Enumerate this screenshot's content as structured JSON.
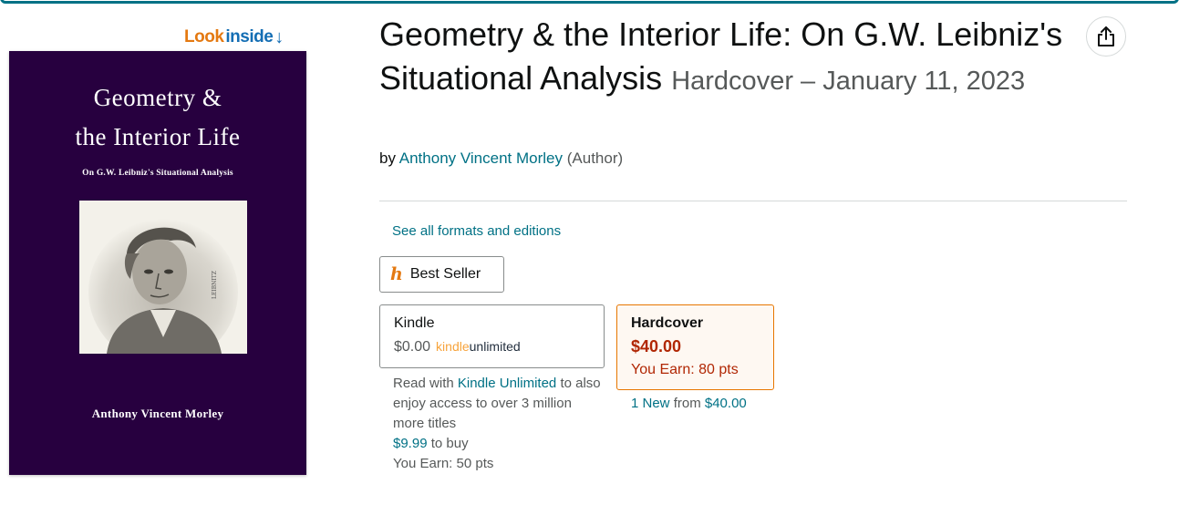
{
  "look_inside": {
    "word1": "Look",
    "word2": "inside",
    "arrow": "↓"
  },
  "cover": {
    "title_line1": "Geometry &",
    "title_line2": "the Interior Life",
    "subtitle": "On G.W. Leibniz's Situational Analysis",
    "author": "Anthony Vincent Morley",
    "portrait_caption": "LEIBNITZ"
  },
  "product": {
    "title": "Geometry & the Interior Life: On G.W. Leibniz's Situational Analysis",
    "format_date": "Hardcover – January 11, 2023",
    "by": "by",
    "author": "Anthony Vincent Morley",
    "role": "(Author)"
  },
  "share": {
    "icon": "share-icon"
  },
  "formats": {
    "see_all": "See all formats and editions",
    "best_seller": "Best Seller",
    "kindle": {
      "name": "Kindle",
      "price": "$0.00",
      "ku_part1": "kindle",
      "ku_part2": "unlimited",
      "read_with": "Read with",
      "ku_link": "Kindle Unlimited",
      "also": "to also enjoy access to over 3 million more titles",
      "buy_price": "$9.99",
      "to_buy": "to buy",
      "earn": "You Earn: 50 pts"
    },
    "hardcover": {
      "name": "Hardcover",
      "price": "$40.00",
      "earn": "You Earn: 80 pts",
      "new_link": "1 New",
      "from": "from",
      "from_price": "$40.00"
    }
  },
  "colors": {
    "link": "#007185",
    "price": "#b12704",
    "selected_border": "#e77600",
    "cover_bg": "#27003f"
  }
}
